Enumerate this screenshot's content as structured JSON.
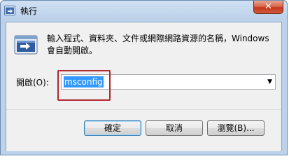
{
  "window": {
    "title": "執行",
    "close_glyph": "✕"
  },
  "description": {
    "line1": "輸入程式、資料夾、文件或網際網路資源的名稱，Windows",
    "line2": "會自動開啟。"
  },
  "open": {
    "label": "開啟(O):",
    "value": "msconfig",
    "dropdown_glyph": "▼"
  },
  "buttons": {
    "ok": "確定",
    "cancel": "取消",
    "browse": "瀏覽(B)..."
  },
  "colors": {
    "accent_highlight": "#b0282e",
    "selection": "#3399ff",
    "close_button": "#c4381c"
  },
  "icons": {
    "title": "run-app-icon",
    "dialog": "run-program-icon"
  }
}
